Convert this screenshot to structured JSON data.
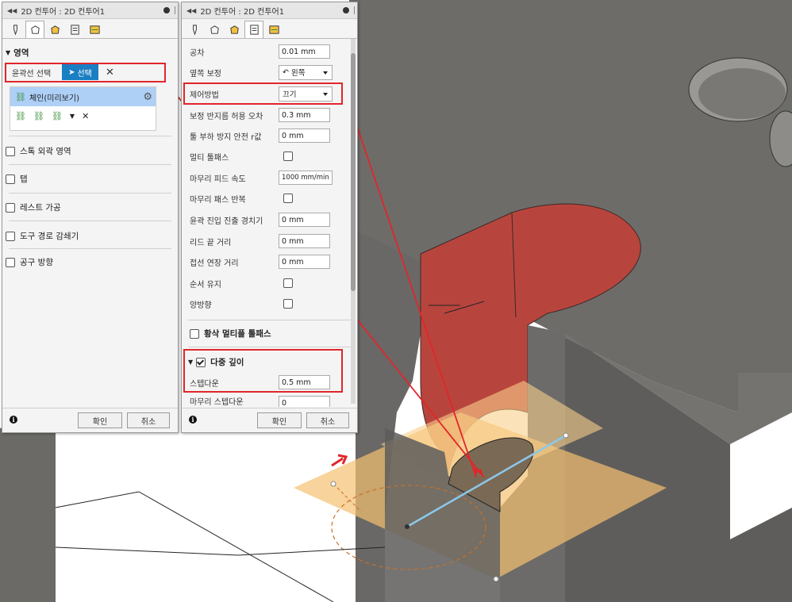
{
  "panel_left": {
    "title": "2D 컨투어 : 2D 컨투어1",
    "section_geometry": "영역",
    "contour_selection_label": "윤곽선 선택",
    "select_button": "선택",
    "chain_item": "체인(미리보기)",
    "options": [
      {
        "label": "스톡 외곽 영역",
        "checked": false
      },
      {
        "label": "탭",
        "checked": false
      },
      {
        "label": "레스트 가공",
        "checked": false
      },
      {
        "label": "도구 경로 감쇄기",
        "checked": false
      },
      {
        "label": "공구 방향",
        "checked": false
      }
    ],
    "ok": "확인",
    "cancel": "취소"
  },
  "panel_right": {
    "title": "2D 컨투어 : 2D 컨투어1",
    "rows": [
      {
        "label": "공차",
        "value": "0.01 mm"
      },
      {
        "label": "옆쪽 보정",
        "value": "왼쪽"
      },
      {
        "label": "제어방법",
        "value": "끄기"
      },
      {
        "label": "보정 반지름 허용 오차",
        "value": "0.3 mm"
      },
      {
        "label": "툴 부하 방지 안전 r값",
        "value": "0 mm"
      },
      {
        "label": "멀티 툴패스",
        "checked": false
      },
      {
        "label": "마무리 피드 속도",
        "value": "1000 mm/min"
      },
      {
        "label": "마무리 패스 반복",
        "checked": false
      },
      {
        "label": "윤곽 진입 진출 경치기",
        "value": "0 mm"
      },
      {
        "label": "리드 끝 거리",
        "value": "0 mm"
      },
      {
        "label": "접선 연장 거리",
        "value": "0 mm"
      },
      {
        "label": "순서 유지",
        "checked": false
      },
      {
        "label": "양방향",
        "checked": false
      }
    ],
    "multi_finish": {
      "label": "황삭 멀티플 툴패스",
      "checked": false
    },
    "multi_depth": {
      "label": "다중 깊이",
      "checked": true
    },
    "stepdown": {
      "label": "스텝다운",
      "value": "0.5 mm"
    },
    "finish_stepdown": {
      "label": "마무리 스텝다운",
      "value": "0"
    },
    "ok": "확인",
    "cancel": "취소"
  },
  "colors": {
    "part_dark": "#5b5a58",
    "part_mid": "#7d7b78",
    "selection_red": "#c0403a",
    "plane_orange": "#f5c070",
    "highlight_box": "#e0262b",
    "select_button_blue": "#1a7ec2",
    "chain_highlight": "#aed0f7"
  }
}
